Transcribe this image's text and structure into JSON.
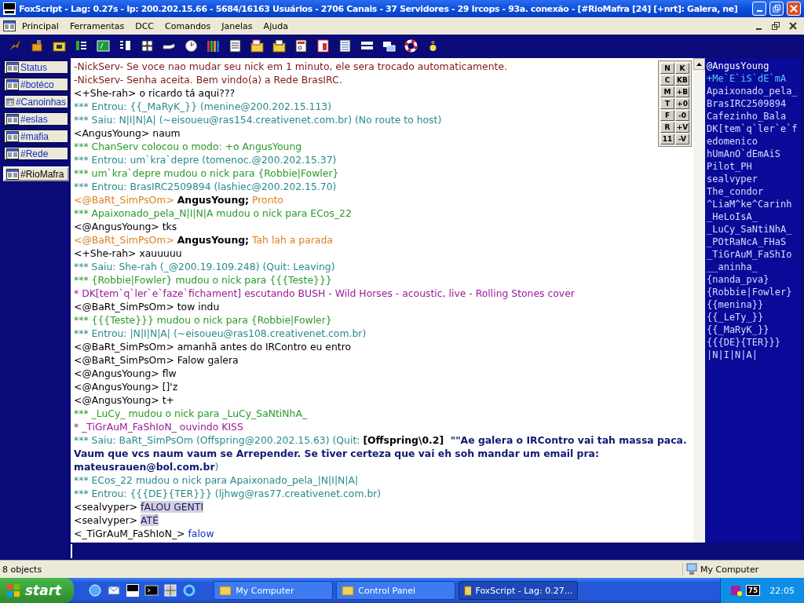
{
  "window": {
    "title": "FoxScript - Lag: 0.27s - Ip: 200.202.15.66 - 5684/16163 Usuários - 2706 Canais - 37 Servidores - 29 Ircops - 93a. conexão - [#RioMafra [24] [+nrt]: Galera, ne]"
  },
  "menu": [
    "Principal",
    "Ferramentas",
    "DCC",
    "Comandos",
    "Janelas",
    "Ajuda"
  ],
  "channels": [
    {
      "label": "Status",
      "selected": false
    },
    {
      "label": "#botéco",
      "selected": false
    },
    {
      "label": "#Canoinhas",
      "selected": false
    },
    {
      "label": "#eslas",
      "selected": false
    },
    {
      "label": "#mafia",
      "selected": false
    },
    {
      "label": "#Rede",
      "selected": false
    },
    {
      "label": "#RioMafra",
      "selected": true
    }
  ],
  "chat": [
    [
      {
        "kind": "notice",
        "text": "-NickServ- Se voce nao mudar seu nick em 1 minuto, ele sera trocado automaticamente."
      }
    ],
    [
      {
        "kind": "notice",
        "text": "-NickServ- Senha aceita. Bem vindo(a) a Rede BrasIRC."
      }
    ],
    [
      {
        "kind": "normal",
        "text": "<+She-rah> o ricardo tá aqui???"
      }
    ],
    [
      {
        "kind": "join",
        "text": "*** Entrou: {{_MaRyK_}} (menine@200.202.15.113)"
      }
    ],
    [
      {
        "kind": "join",
        "text": "*** Saiu: N|I|N|A| (~eisoueu@ras154.creativenet.com.br) (No route to host)"
      }
    ],
    [
      {
        "kind": "normal",
        "text": "<AngusYoung> naum"
      }
    ],
    [
      {
        "kind": "mode",
        "text": "*** ChanServ colocou o modo: +o AngusYoung"
      }
    ],
    [
      {
        "kind": "join",
        "text": "*** Entrou: um`kra`depre (tomenoc.@200.202.15.37)"
      }
    ],
    [
      {
        "kind": "mode",
        "text": "*** um`kra`depre mudou o nick para {Robbie|Fowler}"
      }
    ],
    [
      {
        "kind": "join",
        "text": "*** Entrou: BrasIRC2509894 (lashiec@200.202.15.70)"
      }
    ],
    [
      {
        "kind": "mention",
        "text": "<@BaRt_SimPsOm> "
      },
      {
        "kind": "bold",
        "text": "AngusYoung;"
      },
      {
        "kind": "mention",
        "text": " Pronto"
      }
    ],
    [
      {
        "kind": "mode",
        "text": "*** Apaixonado_pela_N|I|N|A mudou o nick para ECos_22"
      }
    ],
    [
      {
        "kind": "normal",
        "text": "<@AngusYoung> tks"
      }
    ],
    [
      {
        "kind": "mention",
        "text": "<@BaRt_SimPsOm> "
      },
      {
        "kind": "bold",
        "text": "AngusYoung;"
      },
      {
        "kind": "mention",
        "text": " Tah lah a parada"
      }
    ],
    [
      {
        "kind": "normal",
        "text": "<+She-rah> xauuuuu"
      }
    ],
    [
      {
        "kind": "join",
        "text": "*** Saiu: She-rah (_@200.19.109.248) (Quit: Leaving)"
      }
    ],
    [
      {
        "kind": "mode",
        "text": "*** {Robbie|Fowler} mudou o nick para {{{Teste}}}"
      }
    ],
    [
      {
        "kind": "action",
        "text": "* DK[tem`q`ler`e`faze`fichament] escutando BUSH - Wild Horses - acoustic, live - Rolling Stones cover"
      }
    ],
    [
      {
        "kind": "normal",
        "text": "<@BaRt_SimPsOm> tow indu"
      }
    ],
    [
      {
        "kind": "mode",
        "text": "*** {{{Teste}}} mudou o nick para {Robbie|Fowler}"
      }
    ],
    [
      {
        "kind": "join",
        "text": "*** Entrou: |N|I|N|A| (~eisoueu@ras108.creativenet.com.br)"
      }
    ],
    [
      {
        "kind": "normal",
        "text": "<@BaRt_SimPsOm> amanhã antes do IRContro eu entro"
      }
    ],
    [
      {
        "kind": "normal",
        "text": "<@BaRt_SimPsOm> Falow galera"
      }
    ],
    [
      {
        "kind": "normal",
        "text": "<@AngusYoung> flw"
      }
    ],
    [
      {
        "kind": "normal",
        "text": "<@AngusYoung> []'z"
      }
    ],
    [
      {
        "kind": "normal",
        "text": "<@AngusYoung> t+"
      }
    ],
    [
      {
        "kind": "mode",
        "text": "*** _LuCy_ mudou o nick para _LuCy_SaNtiNhA_"
      }
    ],
    [
      {
        "kind": "action",
        "text": "* _TiGrAuM_FaShIoN_ ouvindo KISS"
      }
    ],
    [
      {
        "kind": "join",
        "text": "*** Saiu: BaRt_SimPsOm (Offspring@200.202.15.63) (Quit: "
      },
      {
        "kind": "bold",
        "text": "[Offspring\\0.2]"
      },
      {
        "kind": "strong",
        "text": "  \"\"Ae galera o IRContro vai tah massa paca. Vaum que vcs naum vaum se Arrepender. Se tiver certeza que vai eh soh mandar um email pra: mateusrauen@bol.com.br"
      },
      {
        "kind": "join",
        "text": ")"
      }
    ],
    [
      {
        "kind": "join",
        "text": "*** ECos_22 mudou o nick para Apaixonado_pela_|N|I|N|A|"
      }
    ],
    [
      {
        "kind": "join",
        "text": "*** Entrou: {{{DE}{TER}}} (ljhwg@ras77.creativenet.com.br)"
      }
    ],
    [
      {
        "kind": "normal",
        "text": "<sealvyper> "
      },
      {
        "kind": "highlight",
        "text": "fALOU GENTI"
      }
    ],
    [
      {
        "kind": "normal",
        "text": "<sealvyper> "
      },
      {
        "kind": "highlight",
        "text": "ATÉ"
      }
    ],
    [
      {
        "kind": "normal",
        "text": "<_TiGrAuM_FaShIoN_> "
      },
      {
        "kind": "link",
        "text": "falow"
      }
    ]
  ],
  "mode_buttons": [
    "N",
    "K",
    "C",
    "KB",
    "M",
    "+B",
    "T",
    "+0",
    "F",
    "-0",
    "R",
    "+V",
    "11",
    "-V"
  ],
  "nicks": [
    {
      "text": "@AngusYoung",
      "kind": "op"
    },
    {
      "text": "+Me`E`iS`dE`mA",
      "kind": "voice"
    },
    {
      "text": "Apaixonado_pela_",
      "kind": "user"
    },
    {
      "text": "BrasIRC2509894",
      "kind": "user"
    },
    {
      "text": "Cafezinho_Bala",
      "kind": "user"
    },
    {
      "text": "DK[tem`q`ler`e`f",
      "kind": "user"
    },
    {
      "text": "edomenico",
      "kind": "user"
    },
    {
      "text": "hUmAnO`dEmAiS",
      "kind": "user"
    },
    {
      "text": "Pilot_PH",
      "kind": "user"
    },
    {
      "text": "sealvyper",
      "kind": "user"
    },
    {
      "text": "The_condor",
      "kind": "user"
    },
    {
      "text": "^LiaM^ke^Carinh",
      "kind": "user"
    },
    {
      "text": "_HeLoIsA_",
      "kind": "user"
    },
    {
      "text": "_LuCy_SaNtiNhA_",
      "kind": "user"
    },
    {
      "text": "_POtRaNcA_FHaS",
      "kind": "user"
    },
    {
      "text": "_TiGrAuM_FaShIo",
      "kind": "user"
    },
    {
      "text": "__aninha_",
      "kind": "user"
    },
    {
      "text": "{nanda_pva}",
      "kind": "user"
    },
    {
      "text": "{Robbie|Fowler}",
      "kind": "user"
    },
    {
      "text": "{{menina}}",
      "kind": "user"
    },
    {
      "text": "{{_LeTy_}}",
      "kind": "user"
    },
    {
      "text": "{{_MaRyK_}}",
      "kind": "user"
    },
    {
      "text": "{{{DE}{TER}}}",
      "kind": "user"
    },
    {
      "text": "|N|I|N|A|",
      "kind": "user"
    }
  ],
  "status_bar": {
    "left": "8 objects",
    "right": "My Computer"
  },
  "taskbar": {
    "start": "start",
    "tasks": [
      {
        "label": "My Computer",
        "selected": false
      },
      {
        "label": "Control Panel",
        "selected": false
      },
      {
        "label": "FoxScript - Lag: 0.27...",
        "selected": true
      }
    ],
    "tray_badge": "75",
    "clock": "22:05"
  }
}
